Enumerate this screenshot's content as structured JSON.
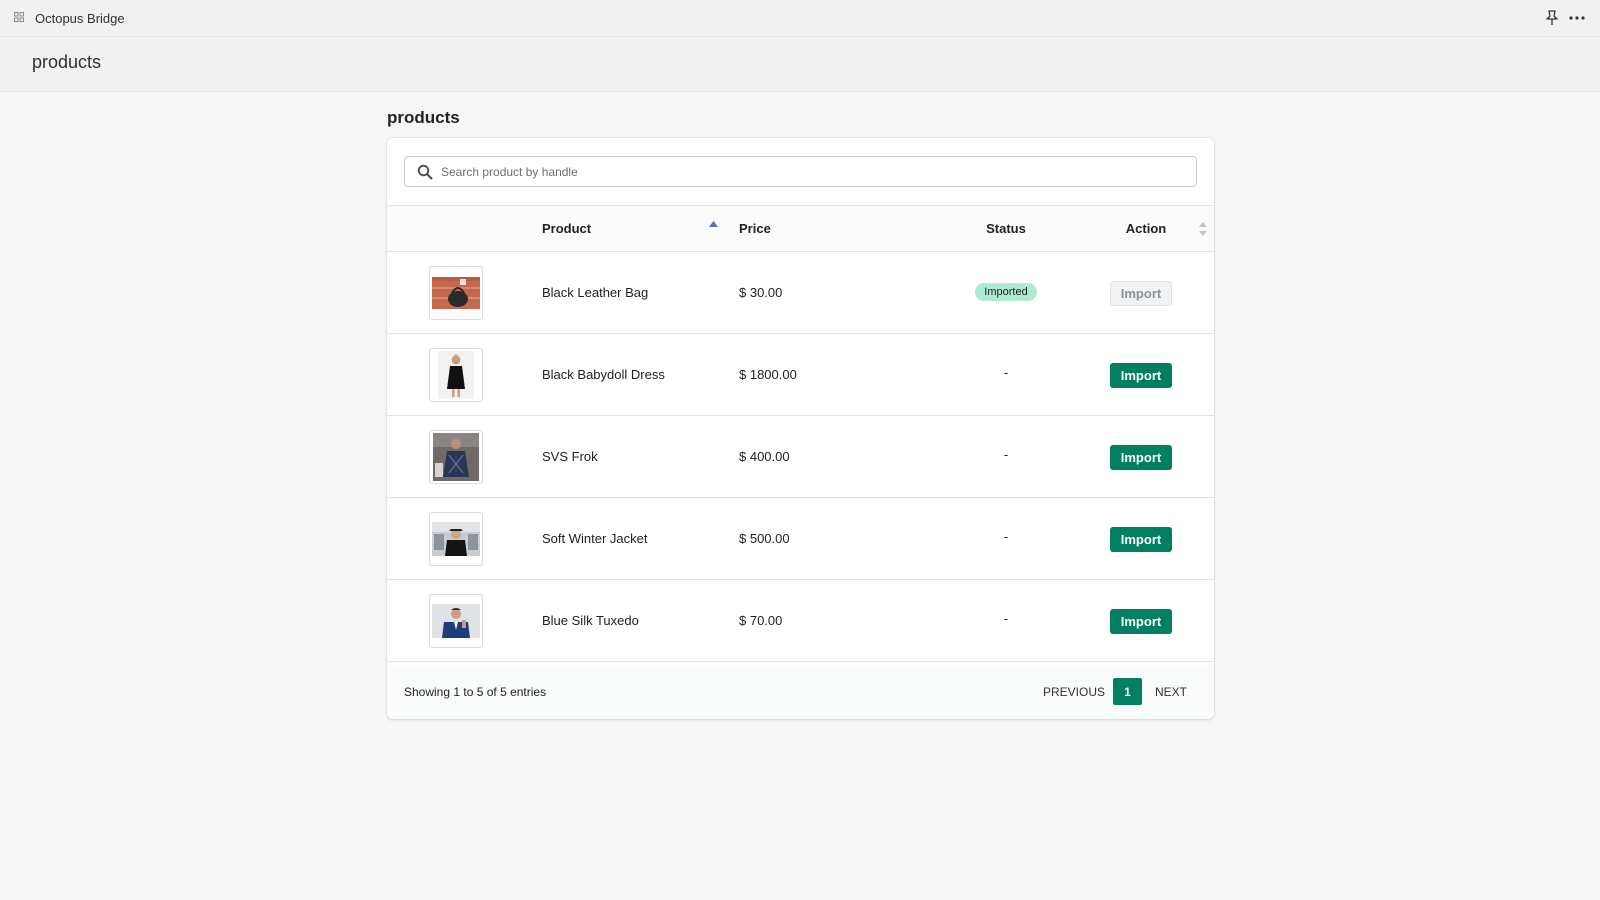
{
  "app": {
    "title": "Octopus Bridge",
    "pin_icon": "pin-icon",
    "more_icon": "more-horizontal-icon"
  },
  "page": {
    "header_title": "products",
    "section_title": "products"
  },
  "search": {
    "placeholder": "Search product by handle",
    "value": ""
  },
  "table": {
    "columns": {
      "product": "Product",
      "price": "Price",
      "status": "Status",
      "action": "Action"
    },
    "sort": {
      "column": "Product",
      "direction": "ascending"
    },
    "rows": [
      {
        "name": "Black Leather Bag",
        "price": "$ 30.00",
        "status": "Imported",
        "action": "Import",
        "action_enabled": false,
        "thumb": "bag-photo"
      },
      {
        "name": "Black Babydoll Dress",
        "price": "$ 1800.00",
        "status": "-",
        "action": "Import",
        "action_enabled": true,
        "thumb": "dress-photo"
      },
      {
        "name": "SVS Frok",
        "price": "$ 400.00",
        "status": "-",
        "action": "Import",
        "action_enabled": true,
        "thumb": "frock-photo"
      },
      {
        "name": "Soft Winter Jacket",
        "price": "$ 500.00",
        "status": "-",
        "action": "Import",
        "action_enabled": true,
        "thumb": "jacket-photo"
      },
      {
        "name": "Blue Silk Tuxedo",
        "price": "$ 70.00",
        "status": "-",
        "action": "Import",
        "action_enabled": true,
        "thumb": "tuxedo-photo"
      }
    ]
  },
  "footer": {
    "showing": "Showing 1 to 5 of 5 entries",
    "previous": "PREVIOUS",
    "current_page": "1",
    "next": "NEXT"
  },
  "colors": {
    "primary": "#008060",
    "badge_imported": "#aee9d1",
    "sort_indicator": "#5c6ac4"
  }
}
